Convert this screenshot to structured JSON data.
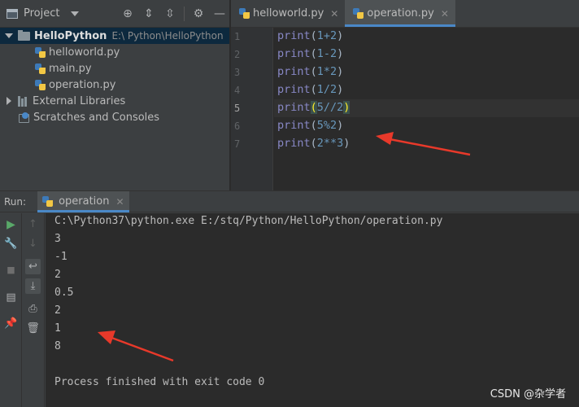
{
  "project_panel": {
    "title": "Project",
    "tree": {
      "root_name": "HelloPython",
      "root_path": "E:\\    Python\\HelloPython",
      "files": [
        "helloworld.py",
        "main.py",
        "operation.py"
      ],
      "external_libraries": "External Libraries",
      "scratches": "Scratches and Consoles"
    }
  },
  "editor": {
    "tabs": [
      {
        "label": "helloworld.py",
        "active": false
      },
      {
        "label": "operation.py",
        "active": true
      }
    ],
    "line_numbers": [
      "1",
      "2",
      "3",
      "4",
      "5",
      "6",
      "7"
    ],
    "code_lines": [
      {
        "fn": "print",
        "args": "1+2"
      },
      {
        "fn": "print",
        "args": "1-2"
      },
      {
        "fn": "print",
        "args": "1*2"
      },
      {
        "fn": "print",
        "args": "1/2"
      },
      {
        "fn": "print",
        "args": "5//2"
      },
      {
        "fn": "print",
        "args": "5%2"
      },
      {
        "fn": "print",
        "args": "2**3"
      }
    ]
  },
  "run_panel": {
    "label": "Run:",
    "tab_label": "operation",
    "command": "C:\\Python37\\python.exe E:/stq/Python/HelloPython/operation.py",
    "outputs": [
      "3",
      "-1",
      "2",
      "0.5",
      "2",
      "1",
      "8"
    ],
    "exit_message": "Process finished with exit code 0"
  },
  "watermark": "CSDN @杂学者",
  "colors": {
    "accent": "#4a88c7",
    "arrow": "#e8392a",
    "editor_bg": "#2b2b2b",
    "panel_bg": "#3c3f41"
  }
}
